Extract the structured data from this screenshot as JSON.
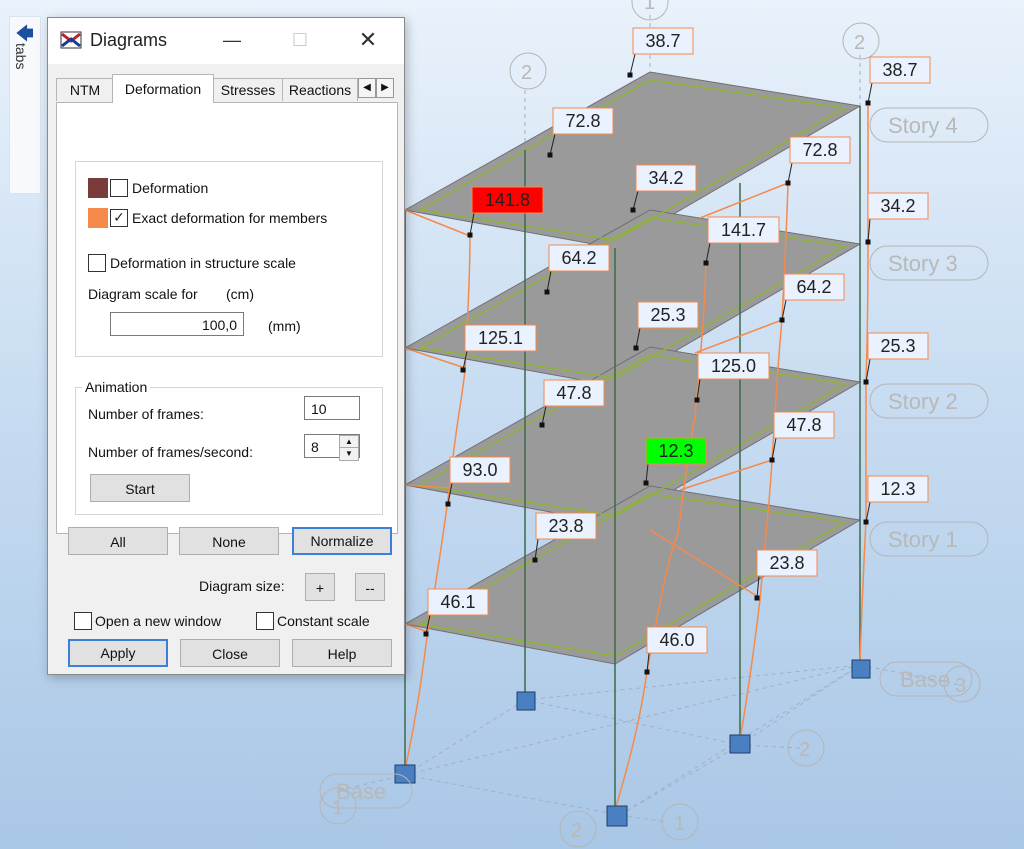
{
  "sidebar": {
    "label": "tabs"
  },
  "dialog": {
    "title": "Diagrams",
    "tabs": [
      "NTM",
      "Deformation",
      "Stresses",
      "Reactions"
    ],
    "active_tab": "Deformation",
    "options": {
      "deformation_label": "Deformation",
      "deformation_color": "#7a3b3b",
      "deformation_checked": false,
      "exact_label": "Exact deformation for members",
      "exact_color": "#f58a4b",
      "exact_checked": true,
      "structure_scale_label": "Deformation in structure scale",
      "structure_scale_checked": false,
      "scale_label": "Diagram scale for",
      "scale_unit": "(cm)",
      "scale_value": "100,0",
      "scale_value_unit": "(mm)"
    },
    "animation": {
      "title": "Animation",
      "frames_label": "Number of frames:",
      "frames_value": "10",
      "fps_label": "Number of frames/second:",
      "fps_value": "8",
      "start_label": "Start"
    },
    "buttons": {
      "all": "All",
      "none": "None",
      "normalize": "Normalize"
    },
    "diagram_size": {
      "label": "Diagram size:",
      "plus": "+",
      "minus": "--"
    },
    "open_new_window": {
      "label": "Open a new window",
      "checked": false
    },
    "constant_scale": {
      "label": "Constant scale",
      "checked": false
    },
    "footer": {
      "apply": "Apply",
      "close": "Close",
      "help": "Help"
    }
  },
  "viewport": {
    "story_labels": [
      "Story 4",
      "Story 3",
      "Story 2",
      "Story 1",
      "Base"
    ],
    "grid_labels": [
      "1",
      "2",
      "3"
    ],
    "values": [
      "38.7",
      "38.7",
      "72.8",
      "72.8",
      "34.2",
      "34.2",
      "141.8",
      "141.7",
      "64.2",
      "64.2",
      "25.3",
      "25.3",
      "125.1",
      "125.0",
      "47.8",
      "47.8",
      "12.3",
      "12.3",
      "93.0",
      "23.8",
      "23.8",
      "46.1",
      "46.0"
    ],
    "max_color": "#ff0000",
    "min_color": "#00ff00"
  }
}
